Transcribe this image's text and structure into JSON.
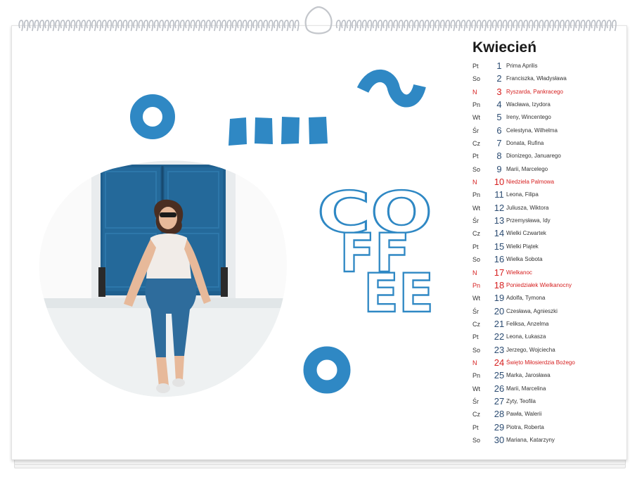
{
  "colors": {
    "accent": "#2f88c4",
    "holiday": "#d62020",
    "number": "#2d4d73"
  },
  "calendar": {
    "month": "Kwiecień",
    "days": [
      {
        "dow": "Pt",
        "num": "1",
        "names": "Prima Aprilis",
        "holiday": false
      },
      {
        "dow": "So",
        "num": "2",
        "names": "Franciszka, Władysława",
        "holiday": false
      },
      {
        "dow": "N",
        "num": "3",
        "names": "Ryszarda, Pankracego",
        "holiday": true
      },
      {
        "dow": "Pn",
        "num": "4",
        "names": "Wacława, Izydora",
        "holiday": false
      },
      {
        "dow": "Wt",
        "num": "5",
        "names": "Ireny, Wincentego",
        "holiday": false
      },
      {
        "dow": "Śr",
        "num": "6",
        "names": "Celestyna, Wilhelma",
        "holiday": false
      },
      {
        "dow": "Cz",
        "num": "7",
        "names": "Donata, Rufina",
        "holiday": false
      },
      {
        "dow": "Pt",
        "num": "8",
        "names": "Dionizego, Januarego",
        "holiday": false
      },
      {
        "dow": "So",
        "num": "9",
        "names": "Marii, Marcelego",
        "holiday": false
      },
      {
        "dow": "N",
        "num": "10",
        "names": "Niedziela Palmowa",
        "holiday": true
      },
      {
        "dow": "Pn",
        "num": "11",
        "names": "Leona, Filipa",
        "holiday": false
      },
      {
        "dow": "Wt",
        "num": "12",
        "names": "Juliusza, Wiktora",
        "holiday": false
      },
      {
        "dow": "Śr",
        "num": "13",
        "names": "Przemysława, Idy",
        "holiday": false
      },
      {
        "dow": "Cz",
        "num": "14",
        "names": "Wielki Czwartek",
        "holiday": false
      },
      {
        "dow": "Pt",
        "num": "15",
        "names": "Wielki Piątek",
        "holiday": false
      },
      {
        "dow": "So",
        "num": "16",
        "names": "Wielka Sobota",
        "holiday": false
      },
      {
        "dow": "N",
        "num": "17",
        "names": "Wielkanoc",
        "holiday": true
      },
      {
        "dow": "Pn",
        "num": "18",
        "names": "Poniedziałek Wielkanocny",
        "holiday": true
      },
      {
        "dow": "Wt",
        "num": "19",
        "names": "Adolfa, Tymona",
        "holiday": false
      },
      {
        "dow": "Śr",
        "num": "20",
        "names": "Czesława, Agnieszki",
        "holiday": false
      },
      {
        "dow": "Cz",
        "num": "21",
        "names": "Feliksa, Anzelma",
        "holiday": false
      },
      {
        "dow": "Pt",
        "num": "22",
        "names": "Leona, Łukasza",
        "holiday": false
      },
      {
        "dow": "So",
        "num": "23",
        "names": "Jerzego, Wojciecha",
        "holiday": false
      },
      {
        "dow": "N",
        "num": "24",
        "names": "Święto Miłosierdzia Bożego",
        "holiday": true
      },
      {
        "dow": "Pn",
        "num": "25",
        "names": "Marka, Jarosława",
        "holiday": false
      },
      {
        "dow": "Wt",
        "num": "26",
        "names": "Marii, Marcelina",
        "holiday": false
      },
      {
        "dow": "Śr",
        "num": "27",
        "names": "Zyty, Teofila",
        "holiday": false
      },
      {
        "dow": "Cz",
        "num": "28",
        "names": "Pawła, Walerii",
        "holiday": false
      },
      {
        "dow": "Pt",
        "num": "29",
        "names": "Piotra, Roberta",
        "holiday": false
      },
      {
        "dow": "So",
        "num": "30",
        "names": "Mariana, Katarzyny",
        "holiday": false
      }
    ]
  },
  "artwork": {
    "word_lines": [
      "CO",
      "FF",
      "EE"
    ],
    "icons": [
      "ring-shape-icon",
      "bars-shape-icon",
      "wave-shape-icon",
      "ring-shape-icon"
    ],
    "photo": "woman-sitting-by-blue-door-photo"
  }
}
